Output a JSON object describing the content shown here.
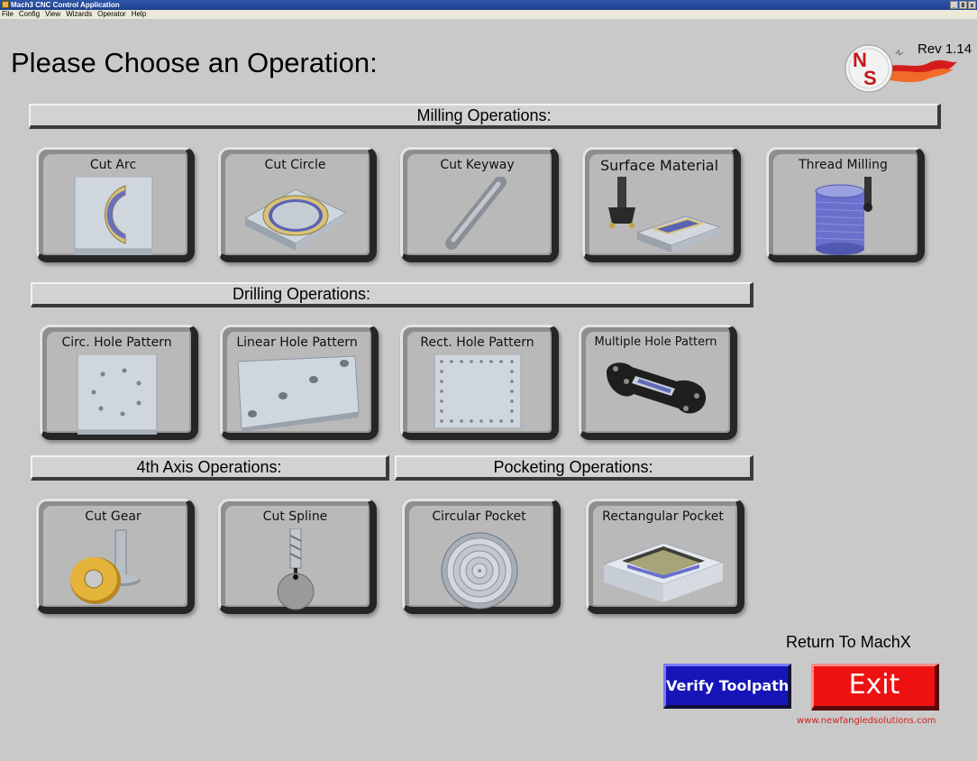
{
  "window": {
    "title": "Mach3 CNC Control Application",
    "controls": [
      "_",
      "8",
      "x"
    ]
  },
  "menu": [
    "File",
    "Config",
    "View",
    "Wizards",
    "Operator",
    "Help"
  ],
  "header": {
    "title": "Please Choose an Operation:",
    "rev": "Rev 1.14"
  },
  "sections": {
    "milling": "Milling Operations:",
    "drilling": "Drilling Operations:",
    "fourth_axis": "4th Axis Operations:",
    "pocketing": "Pocketing Operations:"
  },
  "operations": {
    "milling": [
      {
        "label": "Cut Arc",
        "icon": "cut-arc-icon"
      },
      {
        "label": "Cut Circle",
        "icon": "cut-circle-icon"
      },
      {
        "label": "Cut Keyway",
        "icon": "cut-keyway-icon"
      },
      {
        "label": "Surface Material",
        "icon": "surface-material-icon"
      },
      {
        "label": "Thread Milling",
        "icon": "thread-milling-icon"
      }
    ],
    "drilling": [
      {
        "label": "Circ. Hole Pattern",
        "icon": "circular-hole-pattern-icon"
      },
      {
        "label": "Linear Hole Pattern",
        "icon": "linear-hole-pattern-icon"
      },
      {
        "label": "Rect. Hole Pattern",
        "icon": "rectangular-hole-pattern-icon"
      },
      {
        "label": "Multiple Hole Pattern",
        "icon": "multiple-hole-pattern-icon"
      }
    ],
    "fourth_axis": [
      {
        "label": "Cut Gear",
        "icon": "cut-gear-icon"
      },
      {
        "label": "Cut Spline",
        "icon": "cut-spline-icon"
      }
    ],
    "pocketing": [
      {
        "label": "Circular Pocket",
        "icon": "circular-pocket-icon"
      },
      {
        "label": "Rectangular Pocket",
        "icon": "rectangular-pocket-icon"
      }
    ]
  },
  "footer": {
    "return_label": "Return To MachX",
    "verify_label": "Verify Toolpath",
    "exit_label": "Exit",
    "website": "www.newfangledsolutions.com"
  },
  "colors": {
    "background": "#c9c9c9",
    "verify": "#1616b8",
    "exit": "#ee1111",
    "website": "#d22020"
  }
}
